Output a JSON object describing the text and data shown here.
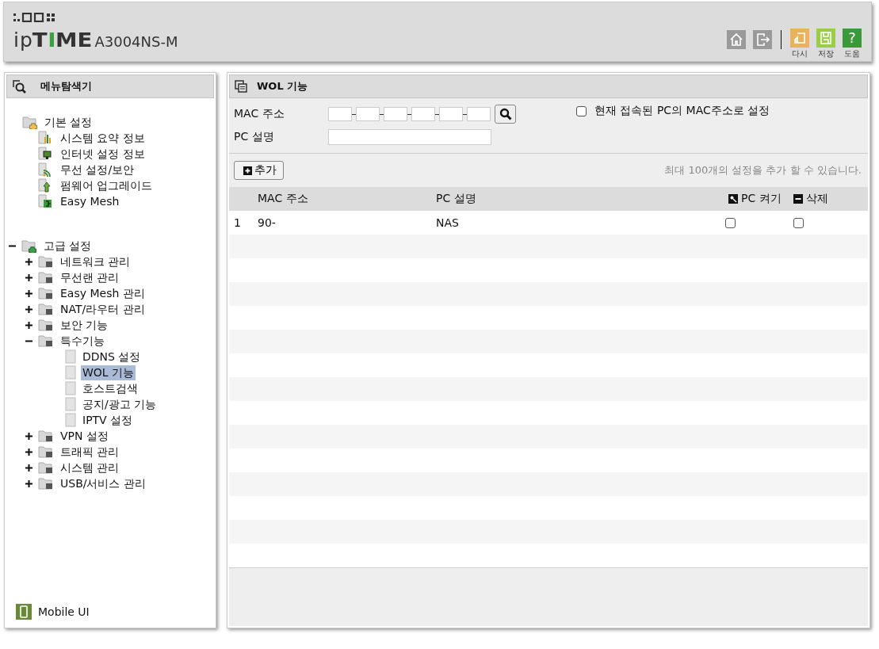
{
  "header": {
    "logo": {
      "prefix": "ip",
      "brand": [
        {
          "text": "T",
          "accent": false
        },
        {
          "text": "I",
          "accent": true
        },
        {
          "text": "ME",
          "accent": false
        }
      ],
      "model": "A3004NS-M"
    },
    "toolbar": [
      {
        "kind": "home"
      },
      {
        "kind": "logout"
      },
      {
        "kind": "undo",
        "label": "다시",
        "color": "#e8b35a"
      },
      {
        "kind": "save",
        "label": "저장",
        "color": "#9ccc4a"
      },
      {
        "kind": "help",
        "label": "도움",
        "glyph": "?",
        "color": "#3a9a3a"
      }
    ]
  },
  "sidebar": {
    "title": "메뉴탐색기",
    "tree": [
      {
        "label": "기본 설정",
        "selected": false,
        "children": [
          {
            "label": "시스템 요약 정보",
            "selected": false
          },
          {
            "label": "인터넷 설정 정보",
            "selected": false
          },
          {
            "label": "무선 설정/보안",
            "selected": false
          },
          {
            "label": "펌웨어 업그레이드",
            "selected": false
          },
          {
            "label": "Easy Mesh",
            "selected": false
          }
        ]
      },
      {
        "label": "고급 설정",
        "selected": false,
        "expanded": true,
        "children": [
          {
            "label": "네트워크 관리",
            "selected": false,
            "expanded": false
          },
          {
            "label": "무선랜 관리",
            "selected": false,
            "expanded": false
          },
          {
            "label": "Easy Mesh 관리",
            "selected": false,
            "expanded": false
          },
          {
            "label": "NAT/라우터 관리",
            "selected": false,
            "expanded": false
          },
          {
            "label": "보안 기능",
            "selected": false,
            "expanded": false
          },
          {
            "label": "특수기능",
            "selected": false,
            "expanded": true,
            "children": [
              {
                "label": "DDNS 설정",
                "selected": false
              },
              {
                "label": "WOL 기능",
                "selected": true
              },
              {
                "label": "호스트검색",
                "selected": false
              },
              {
                "label": "공지/광고 기능",
                "selected": false
              },
              {
                "label": "IPTV 설정",
                "selected": false
              }
            ]
          },
          {
            "label": "VPN 설정",
            "selected": false,
            "expanded": false
          },
          {
            "label": "트래픽 관리",
            "selected": false,
            "expanded": false
          },
          {
            "label": "시스템 관리",
            "selected": false,
            "expanded": false
          },
          {
            "label": "USB/서비스 관리",
            "selected": false,
            "expanded": false
          }
        ]
      }
    ],
    "footer_link": "Mobile UI"
  },
  "panel": {
    "title": "WOL 기능",
    "form": {
      "mac_label": "MAC 주소",
      "pc_label": "PC 설명",
      "use_current": {
        "label": "현재 접속된 PC의 MAC주소로 설정",
        "checked": false
      }
    },
    "add_button": "추가",
    "limit_note": "최대 100개의 설정을 추가 할 수 있습니다.",
    "table": {
      "columns": [
        "MAC 주소",
        "PC 설명",
        "PC 켜기",
        "삭제"
      ],
      "rows": [
        {
          "index": "1",
          "mac": "90-",
          "description": "NAS",
          "wake": false,
          "delete": false
        }
      ]
    }
  }
}
